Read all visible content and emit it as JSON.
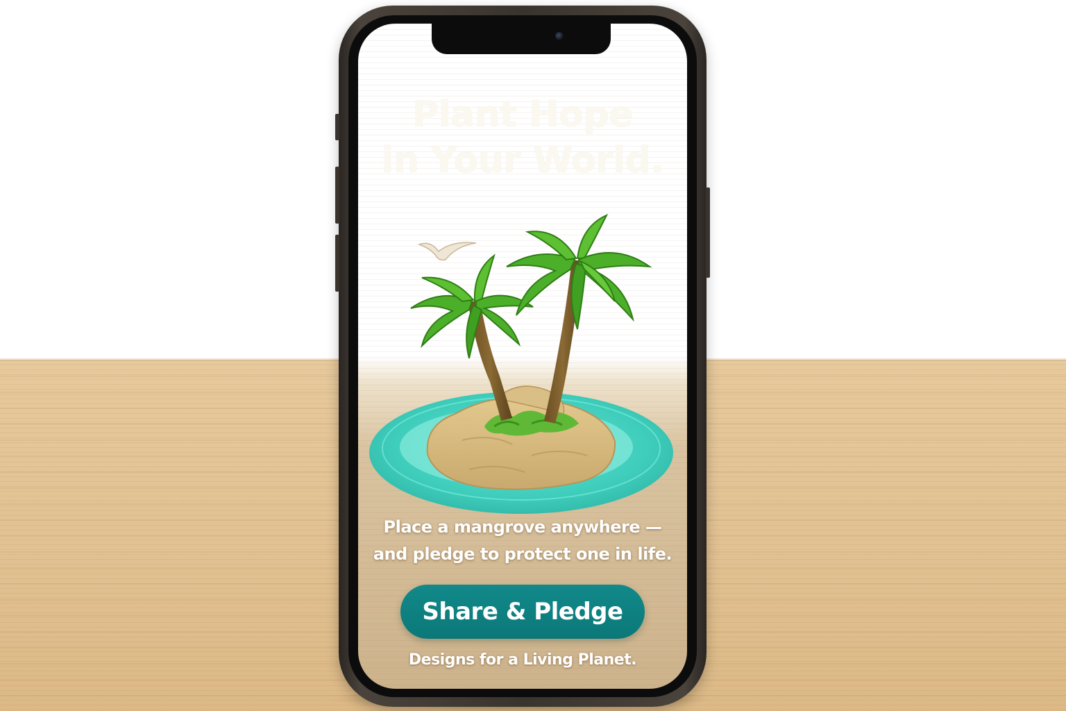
{
  "screen": {
    "headline": {
      "line1": "Plant Hope",
      "line2": "in Your World."
    },
    "illustration": {
      "icon": "palm-island-icon",
      "bird_icon": "seagull-icon"
    },
    "tagline": {
      "line1": "Place a mangrove anywhere —",
      "line2": "and pledge to protect one in life."
    },
    "cta": {
      "label": "Share & Pledge",
      "color": "#0f8383"
    },
    "footer": "Designs for a Living Planet."
  }
}
